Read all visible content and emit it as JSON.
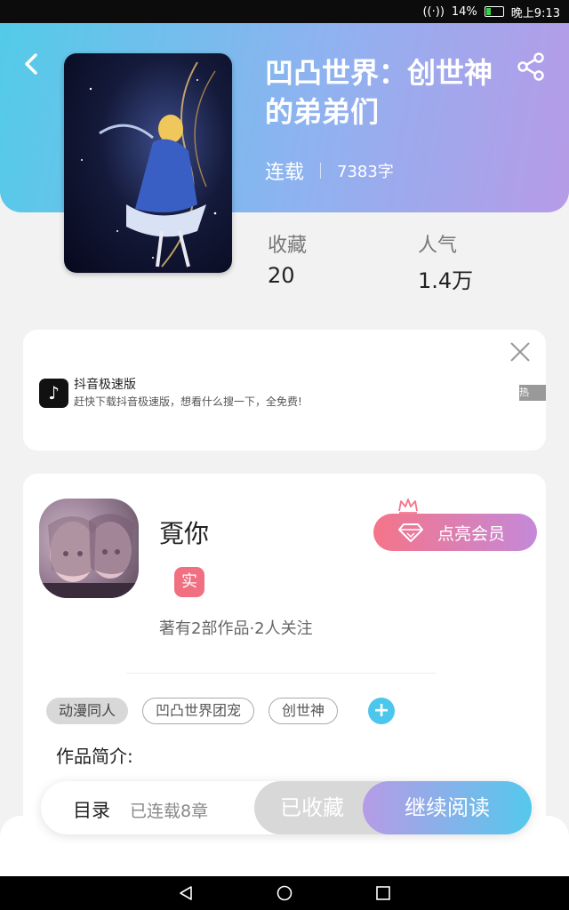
{
  "status_bar": {
    "signal": "14%",
    "time": "晚上9:13"
  },
  "book": {
    "title": "凹凸世界：创世神的弟弟们",
    "title_line1": "凹凸世界：创世神",
    "title_line2": "的弟弟们",
    "status": "连载",
    "word_count": "7383字",
    "stats": [
      {
        "label": "收藏",
        "value": "20"
      },
      {
        "label": "人气",
        "value": "1.4万"
      }
    ]
  },
  "ad": {
    "app_name": "抖音极速版",
    "description": "赶快下载抖音极速版，想看什么搜一下，全免费!",
    "tag": "热"
  },
  "author": {
    "name": "覔你",
    "verified_label": "实",
    "stats": "著有2部作品·2人关注",
    "member_button": "点亮会员"
  },
  "tags": [
    "动漫同人",
    "凹凸世界团宠",
    "创世神"
  ],
  "intro_label": "作品简介:",
  "action_bar": {
    "toc_label": "目录",
    "toc_count": "已连载8章",
    "collected_label": "已收藏",
    "read_label": "继续阅读"
  },
  "colors": {
    "hero_gradient_start": "#53cbe8",
    "hero_gradient_end": "#b69be7",
    "member_gradient_start": "#f57489",
    "member_gradient_end": "#c489d9",
    "verified_badge": "#f06f80",
    "add_tag": "#4cc6ec"
  },
  "icons": {
    "back": "chevron-left-icon",
    "share": "share-icon",
    "close": "close-icon",
    "diamond": "diamond-icon",
    "crown": "crown-icon",
    "add": "plus-icon"
  }
}
